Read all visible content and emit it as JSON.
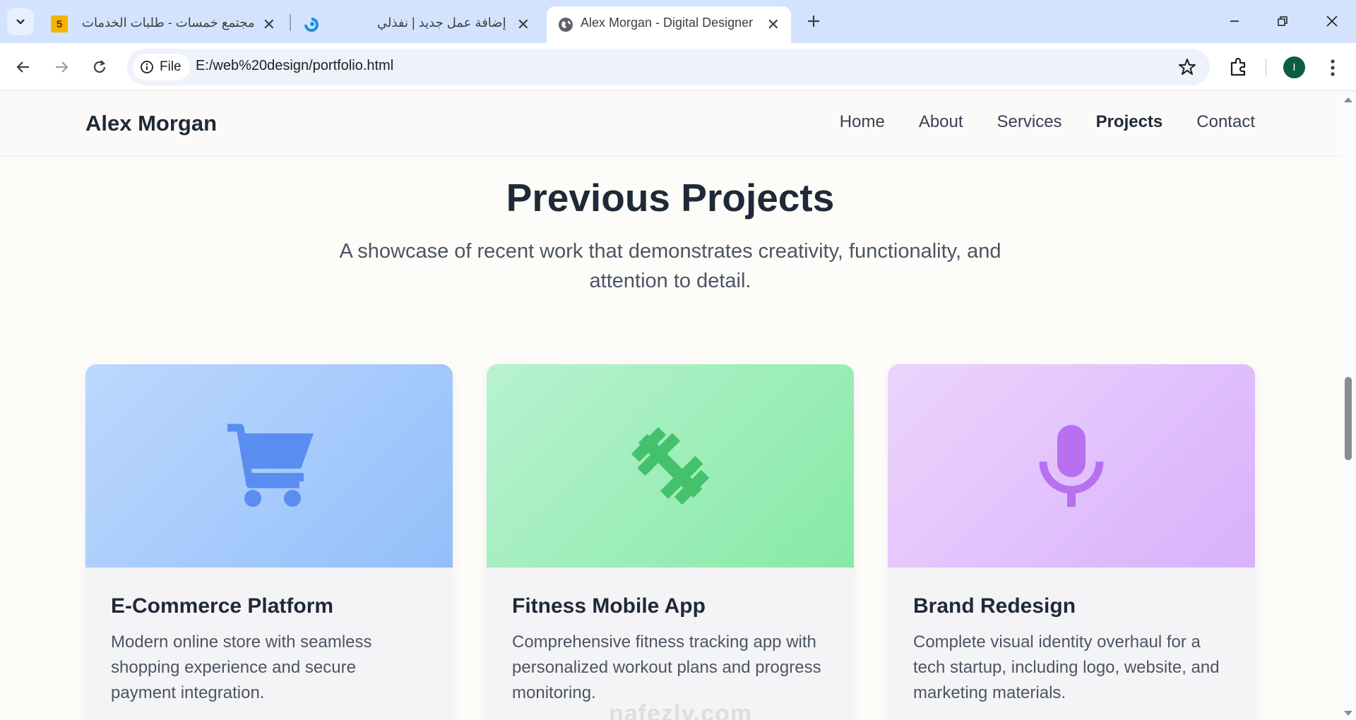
{
  "browser": {
    "tabs": [
      {
        "title": "مجتمع خمسات - طلبات الخدمات",
        "favicon": "khamsat-5-icon",
        "favicon_text": "5",
        "active": false
      },
      {
        "title": "إضافة عمل جديد | نفذلي",
        "favicon": "nafezly-icon",
        "active": false
      },
      {
        "title": "Alex Morgan - Digital Designer",
        "favicon": "globe-icon",
        "active": true
      }
    ],
    "url_chip": "File",
    "url": "E:/web%20design/portfolio.html",
    "profile_initial": "I"
  },
  "site": {
    "brand": "Alex Morgan",
    "nav": [
      "Home",
      "About",
      "Services",
      "Projects",
      "Contact"
    ],
    "active_nav": "Projects"
  },
  "projects": {
    "heading": "Previous Projects",
    "subheading": "A showcase of recent work that demonstrates creativity, functionality, and attention to detail.",
    "items": [
      {
        "title": "E-Commerce Platform",
        "description": "Modern online store with seamless shopping experience and secure payment integration.",
        "icon": "shopping-cart-icon",
        "accent": "#5a8df0"
      },
      {
        "title": "Fitness Mobile App",
        "description": "Comprehensive fitness tracking app with personalized workout plans and progress monitoring.",
        "icon": "dumbbell-icon",
        "accent": "#43c26b"
      },
      {
        "title": "Brand Redesign",
        "description": "Complete visual identity overhaul for a tech startup, including logo, website, and marketing materials.",
        "icon": "microphone-icon",
        "accent": "#b86ff0"
      }
    ]
  },
  "watermark": "nafezly.com"
}
